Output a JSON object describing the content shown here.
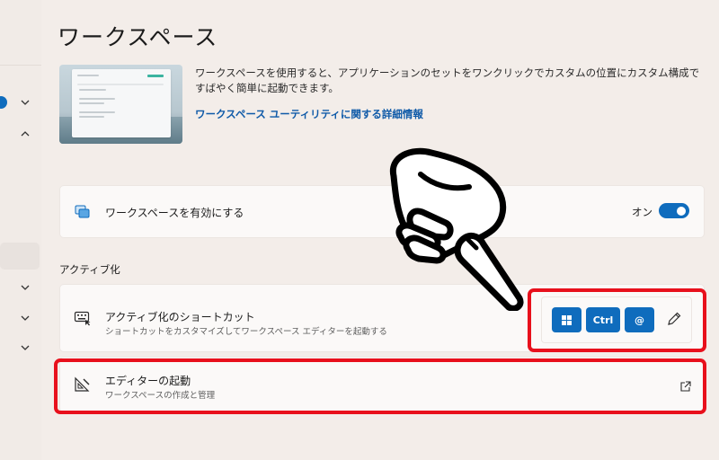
{
  "page": {
    "title": "ワークスペース"
  },
  "hero": {
    "description": "ワークスペースを使用すると、アプリケーションのセットをワンクリックでカスタムの位置にカスタム構成ですばやく簡単に起動できます。",
    "link": "ワークスペース ユーティリティに関する詳細情報"
  },
  "enable_card": {
    "title": "ワークスペースを有効にする",
    "toggle_state": "オン",
    "toggle_on": true
  },
  "activation": {
    "section_label": "アクティブ化",
    "shortcut": {
      "title": "アクティブ化のショートカット",
      "subtitle": "ショートカットをカスタマイズしてワークスペース エディターを起動する",
      "keys": {
        "win": "⊞",
        "ctrl": "Ctrl",
        "at": "@"
      }
    },
    "editor": {
      "title": "エディターの起動",
      "subtitle": "ワークスペースの作成と管理"
    }
  },
  "colors": {
    "accent": "#0f6cbd",
    "highlight": "#e8101c",
    "link": "#0f5aa8",
    "background": "#f3ede9"
  },
  "icons": [
    "chevron-down-icon",
    "chevron-up-icon",
    "workspaces-icon",
    "keyboard-shortcut-icon",
    "editor-icon",
    "pencil-icon",
    "external-link-icon",
    "pointing-hand-icon"
  ]
}
